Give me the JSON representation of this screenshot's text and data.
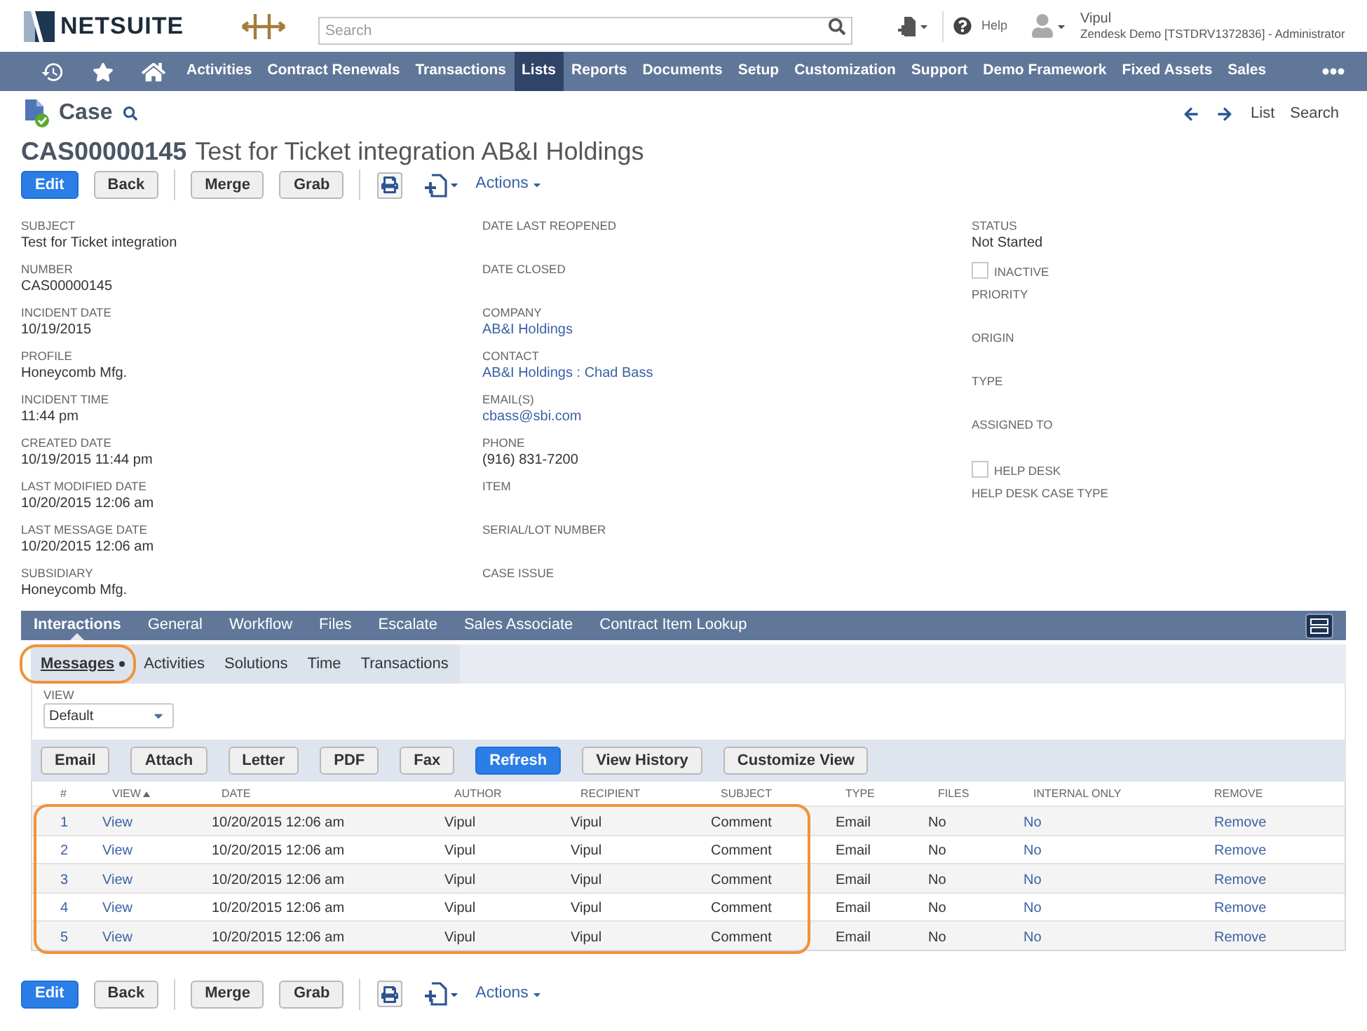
{
  "header": {
    "brand": "NETSUITE",
    "search": {
      "placeholder": "Search"
    },
    "help": "Help",
    "user": {
      "name": "Vipul",
      "account": "Zendesk Demo [TSTDRV1372836] - Administrator"
    }
  },
  "nav": {
    "items": [
      {
        "label": "Activities",
        "selected": false
      },
      {
        "label": "Contract Renewals",
        "selected": false
      },
      {
        "label": "Transactions",
        "selected": false
      },
      {
        "label": "Lists",
        "selected": true
      },
      {
        "label": "Reports",
        "selected": false
      },
      {
        "label": "Documents",
        "selected": false
      },
      {
        "label": "Setup",
        "selected": false
      },
      {
        "label": "Customization",
        "selected": false
      },
      {
        "label": "Support",
        "selected": false
      },
      {
        "label": "Demo Framework",
        "selected": false
      },
      {
        "label": "Fixed Assets",
        "selected": false
      },
      {
        "label": "Sales",
        "selected": false
      }
    ]
  },
  "record": {
    "type": "Case",
    "links": [
      "List",
      "Search"
    ],
    "number": "CAS00000145",
    "title": "Test for Ticket integration AB&I Holdings"
  },
  "toolbar_top": {
    "groups": [
      [
        {
          "label": "Edit",
          "primary": true
        },
        {
          "label": "Back",
          "primary": false
        }
      ],
      [
        {
          "label": "Merge",
          "primary": false
        },
        {
          "label": "Grab",
          "primary": false
        }
      ]
    ],
    "actions": "Actions"
  },
  "fields": {
    "columns": [
      [
        {
          "kind": "text",
          "label": "SUBJECT",
          "value": "Test for Ticket integration"
        },
        {
          "kind": "text",
          "label": "NUMBER",
          "value": "CAS00000145"
        },
        {
          "kind": "text",
          "label": "INCIDENT DATE",
          "value": "10/19/2015"
        },
        {
          "kind": "text",
          "label": "PROFILE",
          "value": "Honeycomb Mfg."
        },
        {
          "kind": "text",
          "label": "INCIDENT TIME",
          "value": "11:44 pm"
        },
        {
          "kind": "text",
          "label": "CREATED DATE",
          "value": "10/19/2015 11:44 pm"
        },
        {
          "kind": "text",
          "label": "LAST MODIFIED DATE",
          "value": "10/20/2015 12:06 am"
        },
        {
          "kind": "text",
          "label": "LAST MESSAGE DATE",
          "value": "10/20/2015 12:06 am"
        },
        {
          "kind": "text",
          "label": "SUBSIDIARY",
          "value": "Honeycomb Mfg."
        }
      ],
      [
        {
          "kind": "text",
          "label": "DATE LAST REOPENED"
        },
        {
          "kind": "text",
          "label": "DATE CLOSED"
        },
        {
          "kind": "link",
          "label": "COMPANY",
          "value": "AB&I Holdings"
        },
        {
          "kind": "link",
          "label": "CONTACT",
          "value": "AB&I Holdings : Chad Bass"
        },
        {
          "kind": "link",
          "label": "EMAIL(S)",
          "value": "cbass@sbi.com"
        },
        {
          "kind": "text",
          "label": "PHONE",
          "value": "(916) 831-7200"
        },
        {
          "kind": "text",
          "label": "ITEM"
        },
        {
          "kind": "text",
          "label": "SERIAL/LOT NUMBER"
        },
        {
          "kind": "text",
          "label": "CASE ISSUE"
        }
      ],
      [
        {
          "kind": "text",
          "label": "STATUS",
          "value": "Not Started"
        },
        {
          "kind": "checkbox",
          "label": "INACTIVE",
          "checked": false
        },
        {
          "kind": "text",
          "label": "PRIORITY"
        },
        {
          "kind": "text",
          "label": "ORIGIN"
        },
        {
          "kind": "text",
          "label": "TYPE"
        },
        {
          "kind": "text",
          "label": "ASSIGNED TO"
        },
        {
          "kind": "checkbox",
          "label": "HELP DESK",
          "checked": false
        },
        {
          "kind": "text",
          "label": "HELP DESK CASE TYPE"
        }
      ]
    ]
  },
  "tabs": [
    {
      "label": "Interactions",
      "selected": true
    },
    {
      "label": "General",
      "selected": false
    },
    {
      "label": "Workflow",
      "selected": false
    },
    {
      "label": "Files",
      "selected": false
    },
    {
      "label": "Escalate",
      "selected": false
    },
    {
      "label": "Sales Associate",
      "selected": false
    },
    {
      "label": "Contract Item Lookup",
      "selected": false
    }
  ],
  "subtabs": [
    {
      "label": "Messages",
      "selected": true,
      "has_data": true,
      "highlighted": true
    },
    {
      "label": "Activities",
      "selected": false,
      "has_data": false,
      "highlighted": false
    },
    {
      "label": "Solutions",
      "selected": false,
      "has_data": false,
      "highlighted": false
    },
    {
      "label": "Time",
      "selected": false,
      "has_data": false,
      "highlighted": false
    },
    {
      "label": "Transactions",
      "selected": false,
      "has_data": false,
      "highlighted": false
    }
  ],
  "messages": {
    "view": {
      "label": "VIEW",
      "value": "Default"
    },
    "buttons": [
      {
        "label": "Email",
        "primary": false
      },
      {
        "label": "Attach",
        "primary": false
      },
      {
        "label": "Letter",
        "primary": false
      },
      {
        "label": "PDF",
        "primary": false
      },
      {
        "label": "Fax",
        "primary": false
      },
      {
        "label": "Refresh",
        "primary": true
      },
      {
        "label": "View History",
        "primary": false
      },
      {
        "label": "Customize View",
        "primary": false
      }
    ],
    "table": {
      "highlighted": true,
      "columns": [
        {
          "label": "#",
          "kind": "link",
          "sorted": false
        },
        {
          "label": "VIEW",
          "kind": "link",
          "sorted": true
        },
        {
          "label": "DATE",
          "kind": "text",
          "sorted": false
        },
        {
          "label": "AUTHOR",
          "kind": "text",
          "sorted": false
        },
        {
          "label": "RECIPIENT",
          "kind": "text",
          "sorted": false
        },
        {
          "label": "SUBJECT",
          "kind": "text",
          "sorted": false
        },
        {
          "label": "TYPE",
          "kind": "text",
          "sorted": false
        },
        {
          "label": "FILES",
          "kind": "text",
          "sorted": false
        },
        {
          "label": "INTERNAL ONLY",
          "kind": "link",
          "sorted": false
        },
        {
          "label": "REMOVE",
          "kind": "link",
          "sorted": false
        }
      ],
      "rows": [
        {
          "cells": [
            "1",
            "View",
            "10/20/2015 12:06 am",
            "Vipul",
            "Vipul",
            "Comment",
            "Email",
            "No",
            "No",
            "Remove"
          ]
        },
        {
          "cells": [
            "2",
            "View",
            "10/20/2015 12:06 am",
            "Vipul",
            "Vipul",
            "Comment",
            "Email",
            "No",
            "No",
            "Remove"
          ]
        },
        {
          "cells": [
            "3",
            "View",
            "10/20/2015 12:06 am",
            "Vipul",
            "Vipul",
            "Comment",
            "Email",
            "No",
            "No",
            "Remove"
          ]
        },
        {
          "cells": [
            "4",
            "View",
            "10/20/2015 12:06 am",
            "Vipul",
            "Vipul",
            "Comment",
            "Email",
            "No",
            "No",
            "Remove"
          ]
        },
        {
          "cells": [
            "5",
            "View",
            "10/20/2015 12:06 am",
            "Vipul",
            "Vipul",
            "Comment",
            "Email",
            "No",
            "No",
            "Remove"
          ]
        }
      ]
    }
  },
  "toolbar_bottom": {
    "groups": [
      [
        {
          "label": "Edit",
          "primary": true
        },
        {
          "label": "Back",
          "primary": false
        }
      ],
      [
        {
          "label": "Merge",
          "primary": false
        },
        {
          "label": "Grab",
          "primary": false
        }
      ]
    ],
    "actions": "Actions"
  }
}
